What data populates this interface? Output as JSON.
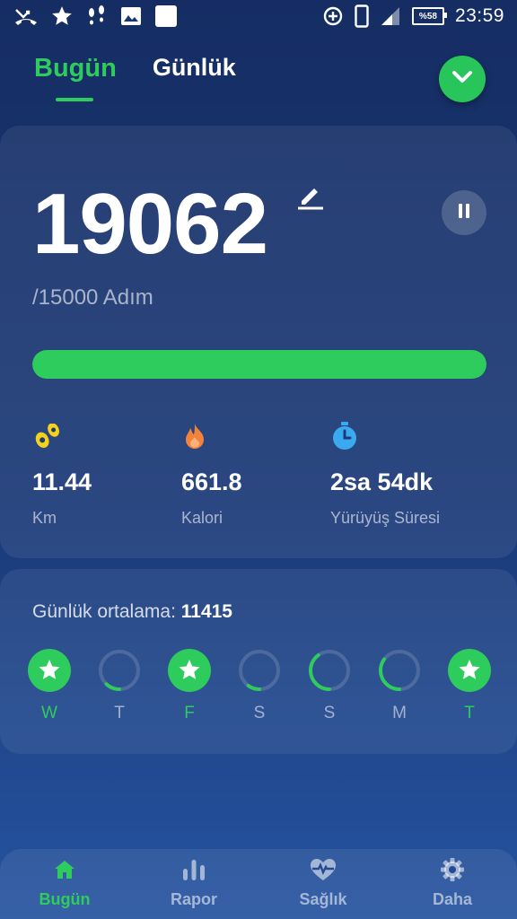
{
  "status_bar": {
    "time": "23:59",
    "battery": "%58",
    "icons": [
      "missed-call-icon",
      "star-icon",
      "footprints-icon",
      "image-icon",
      "blank-notification-icon",
      "data-saver-icon",
      "phone-icon",
      "signal-icon",
      "battery-icon"
    ]
  },
  "tabs": [
    {
      "label": "Bugün",
      "active": true
    },
    {
      "label": "Günlük",
      "active": false
    }
  ],
  "today": {
    "steps": "19062",
    "goal": "/15000 Adım",
    "progress_fraction": 1.0
  },
  "stats": [
    {
      "value": "11.44",
      "label": "Km",
      "icon": "footprints-icon",
      "color": "#f5d21a"
    },
    {
      "value": "661.8",
      "label": "Kalori",
      "icon": "flame-icon",
      "color": "#f2833c"
    },
    {
      "value": "2sa 54dk",
      "label": "Yürüyüş Süresi",
      "icon": "stopwatch-icon",
      "color": "#3aaaf0"
    }
  ],
  "average": {
    "label": "Günlük ortalama: ",
    "value": "11415"
  },
  "week": [
    {
      "label": "W",
      "done": true,
      "progress": 1.0
    },
    {
      "label": "T",
      "done": false,
      "progress": 0.12
    },
    {
      "label": "F",
      "done": true,
      "progress": 1.0
    },
    {
      "label": "S",
      "done": false,
      "progress": 0.1
    },
    {
      "label": "S",
      "done": false,
      "progress": 0.4
    },
    {
      "label": "M",
      "done": false,
      "progress": 0.35
    },
    {
      "label": "T",
      "done": true,
      "progress": 1.0
    }
  ],
  "bottom_nav": [
    {
      "label": "Bugün",
      "icon": "home-icon",
      "active": true
    },
    {
      "label": "Rapor",
      "icon": "bar-chart-icon",
      "active": false
    },
    {
      "label": "Sağlık",
      "icon": "heart-pulse-icon",
      "active": false
    },
    {
      "label": "Daha",
      "icon": "gear-icon",
      "active": false
    }
  ],
  "colors": {
    "accent": "#2ecc5c",
    "background_top": "#152d63",
    "background_bottom": "#2553a0"
  }
}
